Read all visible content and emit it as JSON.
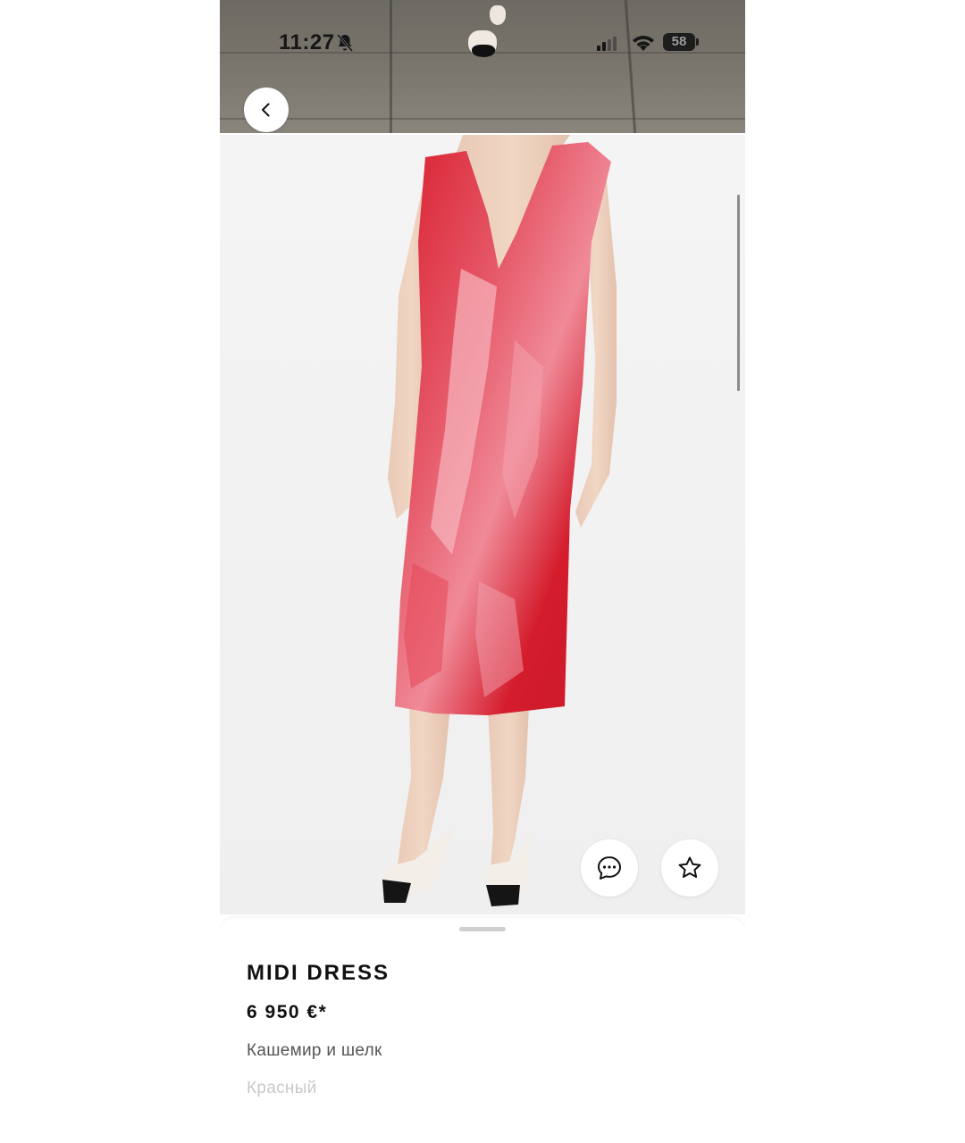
{
  "status_bar": {
    "time": "11:27",
    "battery": "58"
  },
  "nav": {
    "back_icon": "chevron-left-icon"
  },
  "product": {
    "title": "MIDI DRESS",
    "price": "6 950 €*",
    "material": "Кашемир и шелк",
    "color": "Красный"
  },
  "actions": {
    "chat_icon": "chat-bubble-icon",
    "favorite_icon": "star-icon"
  },
  "colors": {
    "dress": "#d8202f",
    "background": "#f1f1f1",
    "text": "#111111"
  }
}
